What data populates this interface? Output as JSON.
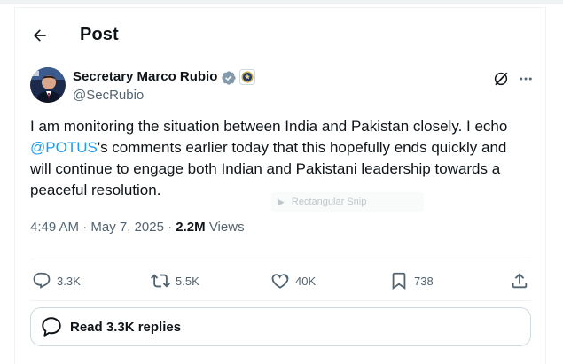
{
  "header": {
    "title": "Post"
  },
  "author": {
    "name": "Secretary Marco Rubio",
    "handle": "@SecRubio"
  },
  "tweet": {
    "text_before": "I am monitoring the situation between India and Pakistan closely. I echo ",
    "mention": "@POTUS",
    "text_after": "'s comments earlier today that this hopefully ends quickly and will continue to engage both Indian and Pakistani leadership towards a peaceful resolution.",
    "time": "4:49 AM",
    "date": "May 7, 2025",
    "views_count": "2.2M",
    "views_label": "Views"
  },
  "actions": {
    "replies": "3.3K",
    "reposts": "5.5K",
    "likes": "40K",
    "bookmarks": "738"
  },
  "read_replies": {
    "label": "Read 3.3K replies"
  },
  "overlay": {
    "label": "Rectangular Snip"
  },
  "icons": {
    "back": "arrow-left-icon",
    "verified": "verified-badge-icon",
    "affiliate": "state-department-seal-icon",
    "grok": "grok-icon",
    "more": "more-icon",
    "reply": "reply-icon",
    "repost": "repost-icon",
    "like": "heart-icon",
    "bookmark": "bookmark-icon",
    "share": "share-icon"
  },
  "colors": {
    "accent": "#1d9bf0",
    "text": "#0f1419",
    "muted": "#536471",
    "border": "#eff3f4"
  }
}
